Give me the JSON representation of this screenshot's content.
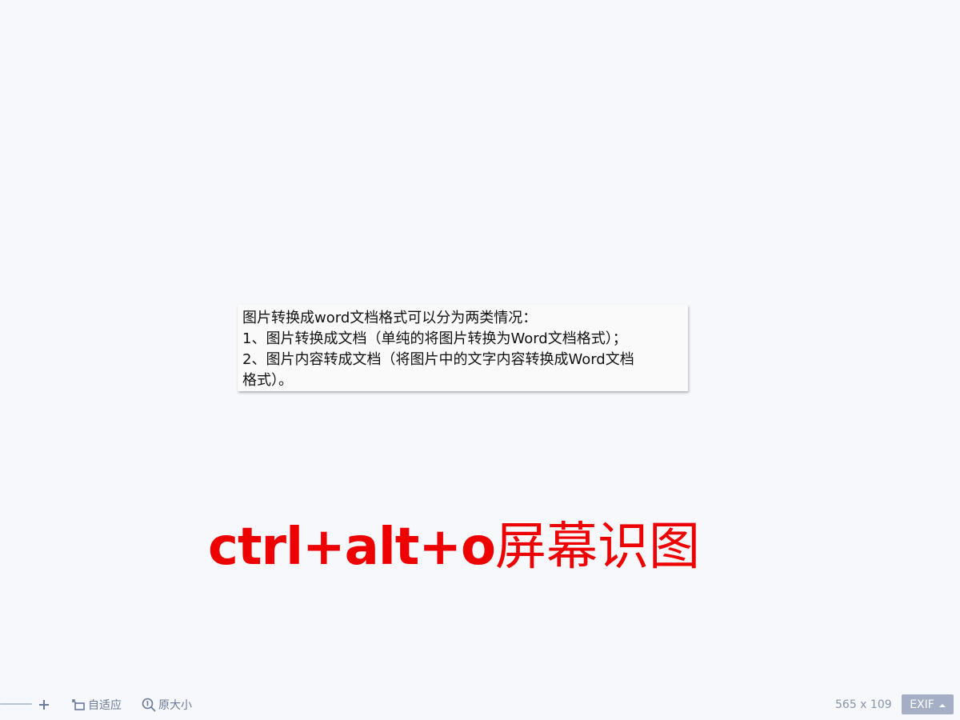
{
  "image": {
    "lines": [
      "图片转换成word文档格式可以分为两类情况：",
      "1、图片转换成文档（单纯的将图片转换为Word文档格式）；",
      "2、图片内容转成文档（将图片中的文字内容转换成Word文档",
      "格式）。"
    ]
  },
  "overlay": {
    "shortcut": "ctrl+alt+o",
    "label": "屏幕识图"
  },
  "toolbar": {
    "fit_label": "自适应",
    "actual_size_label": "原大小",
    "dimensions": "565 x 109",
    "exif_label": "EXIF"
  },
  "colors": {
    "background": "#f6f8fc",
    "overlay_text": "#ee0000",
    "toolbar_text": "#6b7a99",
    "exif_bg": "#a4aec4"
  },
  "icons": {
    "zoom_in": "plus-icon",
    "fit": "fit-screen-icon",
    "actual_size": "magnifier-icon",
    "exif_dropdown": "caret-up-icon"
  }
}
